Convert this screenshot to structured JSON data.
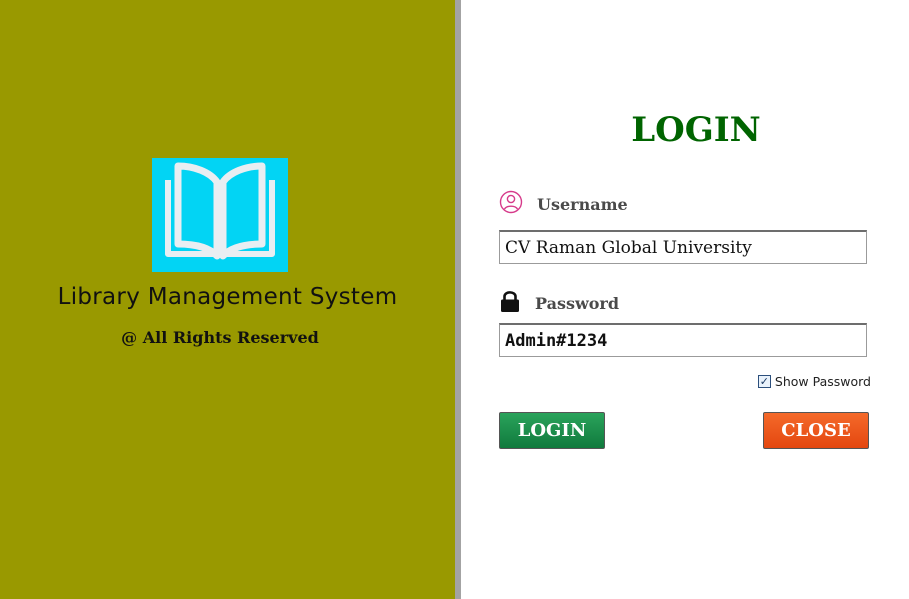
{
  "colors": {
    "left_panel_bg": "#999900",
    "logo_bg": "#02d4f4",
    "heading_color": "#006400",
    "login_button": "#1a8f4a",
    "close_button": "#ee5516"
  },
  "brand": {
    "logo_icon": "open-book-icon",
    "title": "Library Management System",
    "copyright": "@ All Rights Reserved"
  },
  "form": {
    "heading": "LOGIN",
    "username": {
      "icon": "user-circle-icon",
      "label": "Username",
      "value": "CV Raman Global University"
    },
    "password": {
      "icon": "padlock-icon",
      "label": "Password",
      "value": "Admin#1234"
    },
    "show_password": {
      "label": "Show Password",
      "checked": true
    },
    "login_button_label": "LOGIN",
    "close_button_label": "CLOSE"
  }
}
